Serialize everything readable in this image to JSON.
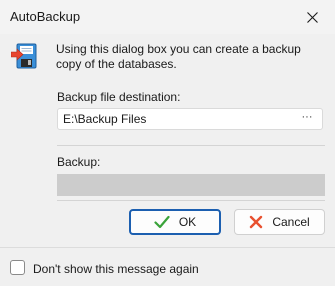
{
  "window": {
    "title": "AutoBackup",
    "close_icon": "close-icon"
  },
  "dialog": {
    "icon": "floppy-backup-icon",
    "intro_text": "Using this dialog box you can create a backup copy of the databases.",
    "destination_label": "Backup file destination:",
    "destination_value": "E:\\Backup Files",
    "browse_label": "···",
    "backup_label": "Backup:",
    "progress": 0
  },
  "buttons": {
    "ok_label": "OK",
    "ok_icon": "checkmark-icon",
    "cancel_label": "Cancel",
    "cancel_icon": "x-icon"
  },
  "footer": {
    "checkbox_label": "Don't show this message again",
    "checked": false
  },
  "colors": {
    "ok_border": "#1c5fb0",
    "checkmark": "#3aa33a",
    "cancel_x": "#e8502f"
  }
}
